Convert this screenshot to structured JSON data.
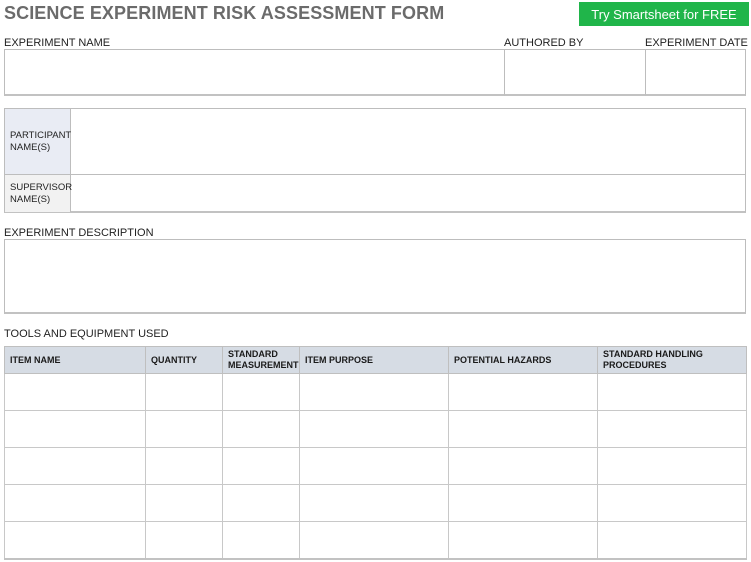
{
  "header": {
    "title": "SCIENCE EXPERIMENT RISK ASSESSMENT FORM",
    "cta_label": "Try Smartsheet for FREE"
  },
  "experiment_info": {
    "name_label": "EXPERIMENT NAME",
    "author_label": "AUTHORED BY",
    "date_label": "EXPERIMENT DATE",
    "name_value": "",
    "author_value": "",
    "date_value": ""
  },
  "participants": {
    "participant_label": "PARTICIPANT NAME(S)",
    "supervisor_label": "SUPERVISOR NAME(S)",
    "participant_value": "",
    "supervisor_value": "",
    "participant_label_bg": "#e9ecf4",
    "supervisor_label_bg": "#f2f2f2"
  },
  "description": {
    "label": "EXPERIMENT DESCRIPTION",
    "value": ""
  },
  "tools": {
    "section_label": "TOOLS AND EQUIPMENT USED",
    "columns": [
      "ITEM NAME",
      "QUANTITY",
      "STANDARD MEASUREMENT",
      "ITEM PURPOSE",
      "POTENTIAL HAZARDS",
      "STANDARD HANDLING PROCEDURES"
    ],
    "rows": [
      [
        "",
        "",
        "",
        "",
        "",
        ""
      ],
      [
        "",
        "",
        "",
        "",
        "",
        ""
      ],
      [
        "",
        "",
        "",
        "",
        "",
        ""
      ],
      [
        "",
        "",
        "",
        "",
        "",
        ""
      ],
      [
        "",
        "",
        "",
        "",
        "",
        ""
      ]
    ],
    "header_bg": "#d6dce4"
  },
  "colors": {
    "title": "#6b6b6b",
    "cta": "#20b54a",
    "border": "#bdbdbd"
  }
}
